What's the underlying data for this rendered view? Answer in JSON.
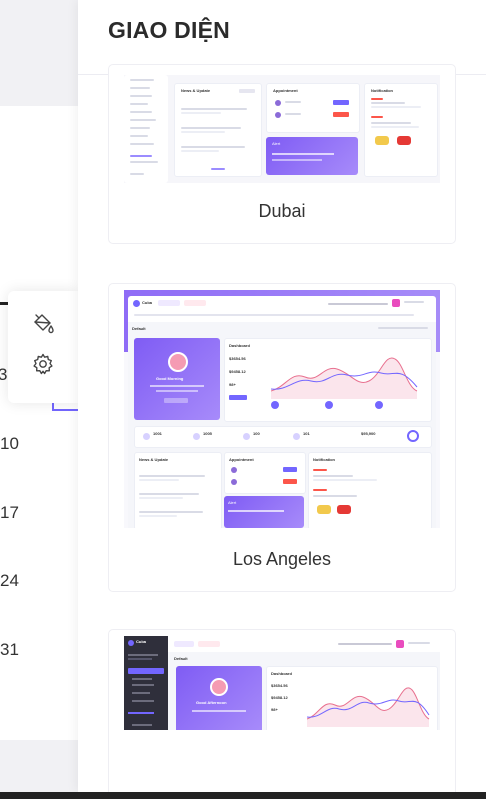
{
  "panel": {
    "title": "GIAO DIỆN",
    "themes": [
      {
        "name": "Dubai"
      },
      {
        "name": "Los Angeles"
      }
    ]
  },
  "background": {
    "calendar_numbers": [
      "3",
      "10",
      "17",
      "24",
      "31"
    ]
  },
  "floating_toolbar": {
    "items": [
      {
        "icon": "paint-bucket-icon"
      },
      {
        "icon": "gear-icon"
      }
    ]
  },
  "preview": {
    "brand": "Cuba",
    "page_label": "Default",
    "welcome_morning": "Good Morning",
    "welcome_afternoon": "Good Afternoon",
    "news_title": "News & Update",
    "appointment_title": "Appointment",
    "notification_title": "Notification",
    "alert_title": "Alert",
    "stats": [
      "1001",
      "1005",
      "100",
      "101"
    ],
    "total_value": "$95,900",
    "dashboard_label": "Dashboard",
    "value_a": "$3654.56",
    "value_b": "$9458.12",
    "value_c": "98+"
  },
  "colors": {
    "accent": "#7366ff",
    "purple_gradient_start": "#7f5cf4",
    "purple_gradient_end": "#a78bfa",
    "dark_sidebar": "#2f2f3b"
  }
}
